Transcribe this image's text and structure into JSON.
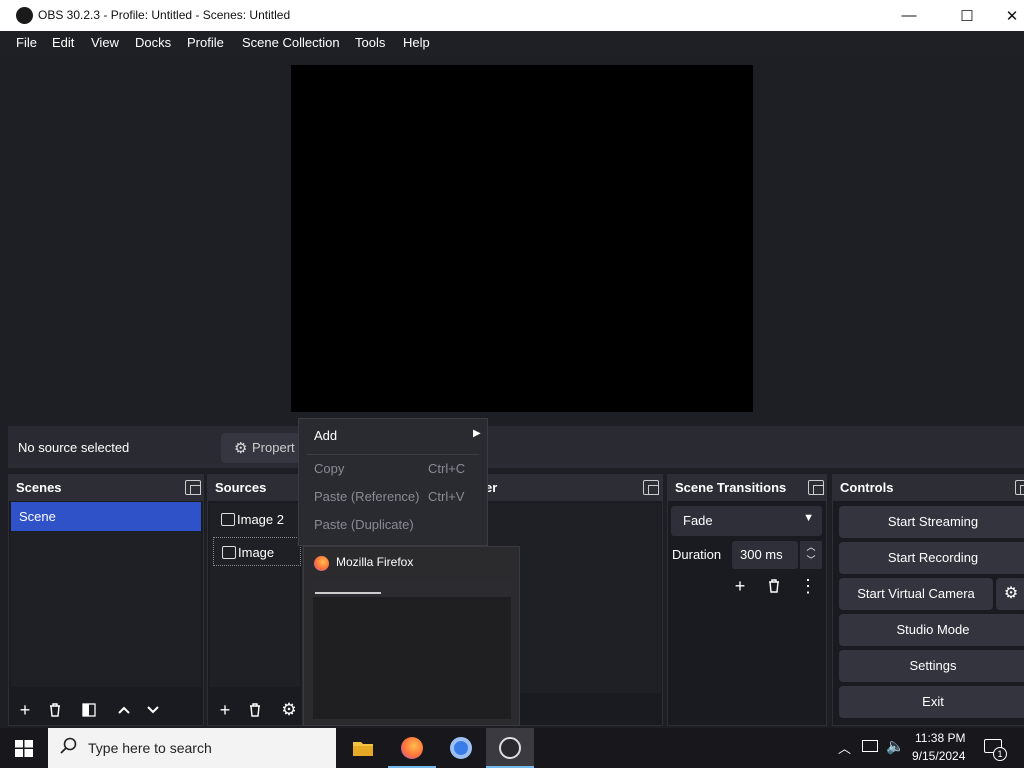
{
  "window": {
    "title": "OBS 30.2.3 - Profile: Untitled - Scenes: Untitled",
    "minimize": "—",
    "maximize": "☐",
    "close": "✕"
  },
  "menu": [
    "File",
    "Edit",
    "View",
    "Docks",
    "Profile",
    "Scene Collection",
    "Tools",
    "Help"
  ],
  "source_toolbar": {
    "status": "No source selected",
    "properties_label": "Propert",
    "properties_icon": "gear-icon"
  },
  "scenes": {
    "title": "Scenes",
    "items": [
      "Scene"
    ]
  },
  "sources": {
    "title": "Sources",
    "items": [
      "Image 2",
      "Image"
    ]
  },
  "mixer": {
    "title_fragment": "er"
  },
  "transitions": {
    "title": "Scene Transitions",
    "selected": "Fade",
    "duration_label": "Duration",
    "duration_value": "300 ms"
  },
  "controls": {
    "title": "Controls",
    "buttons": [
      "Start Streaming",
      "Start Recording",
      "Start Virtual Camera",
      "Studio Mode",
      "Settings",
      "Exit"
    ]
  },
  "context_menu": {
    "add": "Add",
    "copy": "Copy",
    "copy_shortcut": "Ctrl+C",
    "paste_ref": "Paste (Reference)",
    "paste_ref_shortcut": "Ctrl+V",
    "paste_dup": "Paste (Duplicate)"
  },
  "taskbar_preview": {
    "title": "Mozilla Firefox"
  },
  "taskbar": {
    "search_placeholder": "Type here to search",
    "time": "11:38 PM",
    "date": "9/15/2024",
    "notification_count": "1",
    "accent": "#76b9ed"
  },
  "colors": {
    "selected_scene": "#2f52c8",
    "background": "#1e1f24"
  }
}
